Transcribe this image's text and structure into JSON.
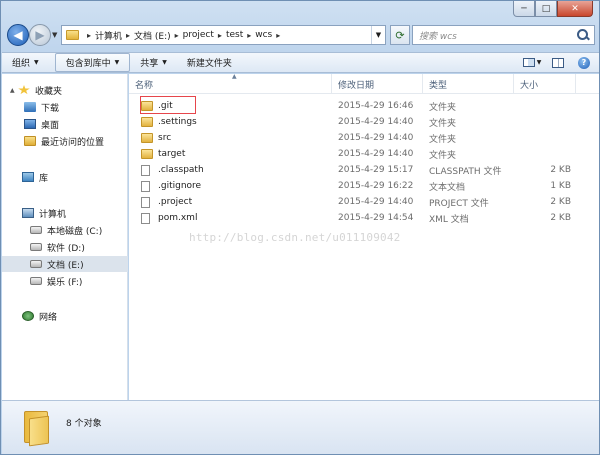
{
  "window": {
    "caption_min": "─",
    "caption_max": "□",
    "caption_close": "✕"
  },
  "navigation": {
    "back_glyph": "◀",
    "forward_glyph": "▶",
    "breadcrumbs": [
      "计算机",
      "文档 (E:)",
      "project",
      "test",
      "wcs"
    ],
    "search_placeholder": "搜索 wcs"
  },
  "toolbar": {
    "organize": "组织",
    "include_in_library": "包含到库中",
    "share": "共享",
    "new_folder": "新建文件夹"
  },
  "sidebar": {
    "favorites": {
      "label": "收藏夹",
      "items": [
        {
          "label": "下载",
          "icon": "download-icon"
        },
        {
          "label": "桌面",
          "icon": "desktop-icon"
        },
        {
          "label": "最近访问的位置",
          "icon": "recent-places-icon"
        }
      ]
    },
    "libraries": {
      "label": "库"
    },
    "computer": {
      "label": "计算机",
      "drives": [
        {
          "label": "本地磁盘 (C:)"
        },
        {
          "label": "软件 (D:)"
        },
        {
          "label": "文档 (E:)",
          "selected": true
        },
        {
          "label": "娱乐 (F:)"
        }
      ]
    },
    "network": {
      "label": "网络"
    }
  },
  "columns": {
    "name": "名称",
    "modified": "修改日期",
    "type": "类型",
    "size": "大小"
  },
  "files": [
    {
      "name": ".git",
      "modified": "2015-4-29 16:46",
      "type": "文件夹",
      "size": "",
      "kind": "folder"
    },
    {
      "name": ".settings",
      "modified": "2015-4-29 14:40",
      "type": "文件夹",
      "size": "",
      "kind": "folder"
    },
    {
      "name": "src",
      "modified": "2015-4-29 14:40",
      "type": "文件夹",
      "size": "",
      "kind": "folder"
    },
    {
      "name": "target",
      "modified": "2015-4-29 14:40",
      "type": "文件夹",
      "size": "",
      "kind": "folder"
    },
    {
      "name": ".classpath",
      "modified": "2015-4-29 15:17",
      "type": "CLASSPATH 文件",
      "size": "2 KB",
      "kind": "file"
    },
    {
      "name": ".gitignore",
      "modified": "2015-4-29 16:22",
      "type": "文本文档",
      "size": "1 KB",
      "kind": "file"
    },
    {
      "name": ".project",
      "modified": "2015-4-29 14:40",
      "type": "PROJECT 文件",
      "size": "2 KB",
      "kind": "file"
    },
    {
      "name": "pom.xml",
      "modified": "2015-4-29 14:54",
      "type": "XML 文档",
      "size": "2 KB",
      "kind": "file"
    }
  ],
  "watermark": "http://blog.csdn.net/u011109042",
  "details": {
    "item_count": "8 个对象"
  },
  "colors": {
    "highlight_border": "#e6454b",
    "selected_nav": "#dbe3ec",
    "folder_yellow": "#e2b340"
  }
}
